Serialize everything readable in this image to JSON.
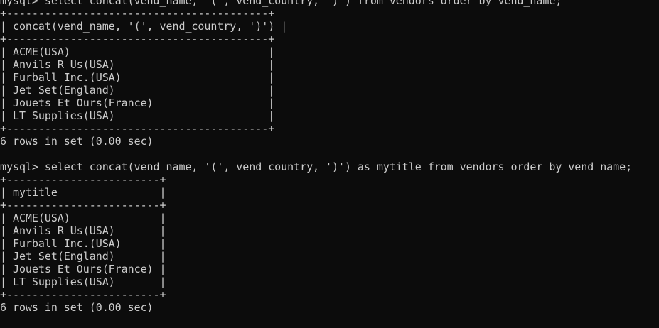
{
  "terminal": {
    "lines": [
      "mysql> select concat(vend_name, '(', vend_country, ')') from vendors order by vend_name;",
      "+-----------------------------------------+",
      "| concat(vend_name, '(', vend_country, ')') |",
      "+-----------------------------------------+",
      "| ACME(USA)                               |",
      "| Anvils R Us(USA)                        |",
      "| Furball Inc.(USA)                       |",
      "| Jet Set(England)                        |",
      "| Jouets Et Ours(France)                  |",
      "| LT Supplies(USA)                        |",
      "+-----------------------------------------+",
      "6 rows in set (0.00 sec)",
      "",
      "mysql> select concat(vend_name, '(', vend_country, ')') as mytitle from vendors order by vend_name;",
      "+------------------------+",
      "| mytitle                |",
      "+------------------------+",
      "| ACME(USA)              |",
      "| Anvils R Us(USA)       |",
      "| Furball Inc.(USA)      |",
      "| Jet Set(England)       |",
      "| Jouets Et Ours(France) |",
      "| LT Supplies(USA)       |",
      "+------------------------+",
      "6 rows in set (0.00 sec)",
      ""
    ]
  }
}
